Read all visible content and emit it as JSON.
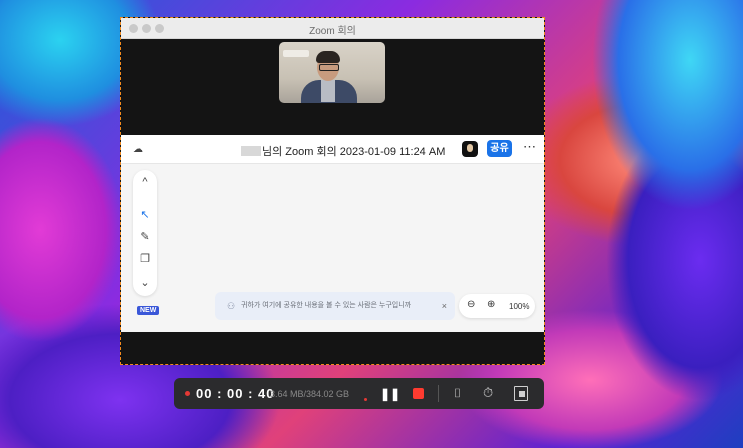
{
  "window": {
    "title": "Zoom 회의"
  },
  "meeting": {
    "title_suffix": "님의 Zoom 회의 2023-01-09 11:24 AM",
    "share_label": "공유",
    "more_label": "⋯"
  },
  "toolbar": {
    "up_icon": "^",
    "pointer_icon": "↖",
    "pen_icon": "✎",
    "copy_icon": "❐",
    "down_icon": "⌄",
    "new_badge": "NEW"
  },
  "notice": {
    "text": "귀하가 여기에 공유한 내용을 볼 수 있는 사람은 누구입니까",
    "close": "×"
  },
  "zoom_controls": {
    "level": "100%"
  },
  "recorder": {
    "timer": "00 : 00 : 40",
    "size": "3.64 MB/384.02 GB"
  },
  "colors": {
    "accent": "#1a73e8",
    "record": "#ff3b30",
    "dash_border": "#f28a1c"
  }
}
